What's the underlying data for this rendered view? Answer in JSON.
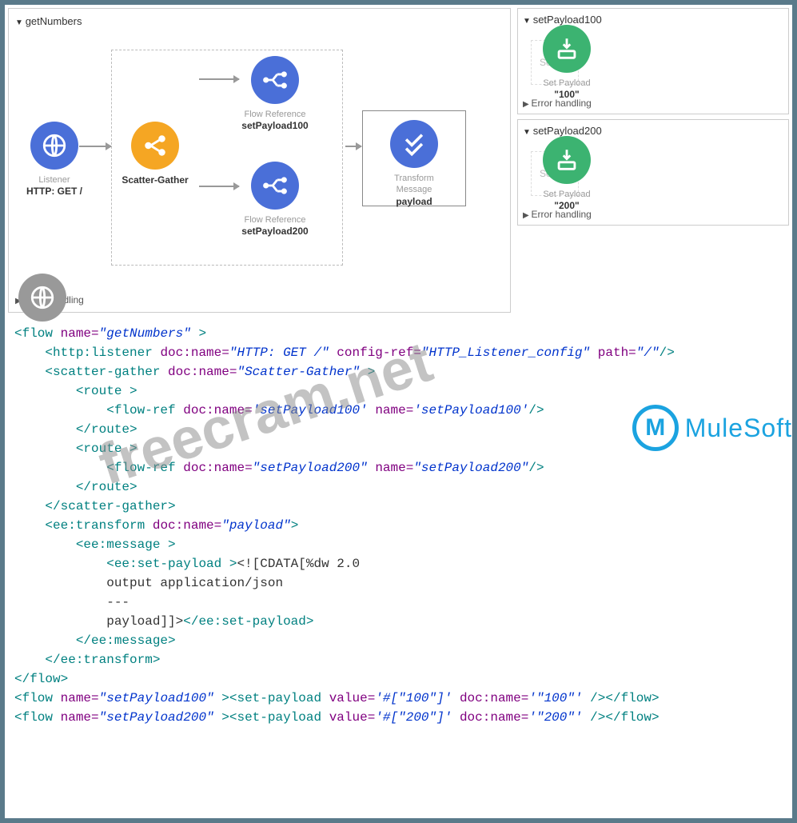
{
  "flows": {
    "main": {
      "name": "getNumbers",
      "listener": {
        "label": "Listener",
        "sublabel": "HTTP: GET /"
      },
      "scatterGather": {
        "label": "Scatter-Gather"
      },
      "flowRef1": {
        "label": "Flow Reference",
        "sublabel": "setPayload100"
      },
      "flowRef2": {
        "label": "Flow Reference",
        "sublabel": "setPayload200"
      },
      "transform": {
        "label": "Transform Message",
        "sublabel": "payload"
      },
      "errorHandling": "Error handling"
    },
    "side1": {
      "name": "setPayload100",
      "source": "Source",
      "setPayload": {
        "label": "Set Payload",
        "value": "\"100\""
      },
      "errorHandling": "Error handling"
    },
    "side2": {
      "name": "setPayload200",
      "source": "Source",
      "setPayload": {
        "label": "Set Payload",
        "value": "\"200\""
      },
      "errorHandling": "Error handling"
    }
  },
  "code": {
    "l1": {
      "tag": "<flow",
      "attr1": "name=",
      "val1": "\"getNumbers\"",
      "close": " >"
    },
    "l2": {
      "tag": "<http:listener",
      "attr1": "doc:name=",
      "val1": "\"HTTP: GET /\"",
      "attr2": "config-ref=",
      "val2": "\"HTTP_Listener_config\"",
      "attr3": "path=",
      "val3": "\"/\"",
      "close": "/>"
    },
    "l3": {
      "tag": "<scatter-gather",
      "attr1": "doc:name=",
      "val1": "\"Scatter-Gather\"",
      "close": " >"
    },
    "l4": {
      "tag": "<route >"
    },
    "l5": {
      "tag": "<flow-ref",
      "attr1": "doc:name=",
      "val1": "'setPayload100'",
      "attr2": "name=",
      "val2": "'setPayload100'",
      "close": "/>"
    },
    "l6": {
      "tag": "</route>"
    },
    "l7": {
      "tag": "<route >"
    },
    "l8": {
      "tag": "<flow-ref",
      "attr1": "doc:name=",
      "val1": "\"setPayload200\"",
      "attr2": "name=",
      "val2": "\"setPayload200\"",
      "close": "/>"
    },
    "l9": {
      "tag": "</route>"
    },
    "l10": {
      "tag": "</scatter-gather>"
    },
    "l11": {
      "tag": "<ee:transform",
      "attr1": "doc:name=",
      "val1": "\"payload\"",
      "close": ">"
    },
    "l12": {
      "tag": "<ee:message >"
    },
    "l13": {
      "tag": "<ee:set-payload >",
      "txt": "<![CDATA[%dw 2.0"
    },
    "l14": {
      "txt": "output application/json"
    },
    "l15": {
      "txt": "---"
    },
    "l16": {
      "txt": "payload",
      "txt2": "]]>",
      "tag": "</ee:set-payload>"
    },
    "l17": {
      "tag": "</ee:message>"
    },
    "l18": {
      "tag": "</ee:transform>"
    },
    "l19": {
      "tag": "</flow>"
    },
    "l20": {
      "tag1": "<flow",
      "attr1": "name=",
      "val1": "\"setPayload100\"",
      "close1": " >",
      "tag2": "<set-payload",
      "attr2": "value=",
      "val2": "'#[\"100\"]'",
      "attr3": "doc:name=",
      "val3": "'\"100\"'",
      "close2": " />",
      "tag3": "</flow>"
    },
    "l21": {
      "tag1": "<flow",
      "attr1": "name=",
      "val1": "\"setPayload200\"",
      "close1": " >",
      "tag2": "<set-payload",
      "attr2": "value=",
      "val2": "'#[\"200\"]'",
      "attr3": "doc:name=",
      "val3": "'\"200\"'",
      "close2": " />",
      "tag3": "</flow>"
    }
  },
  "watermark1": "freecram.net",
  "mulesoft": "MuleSoft"
}
